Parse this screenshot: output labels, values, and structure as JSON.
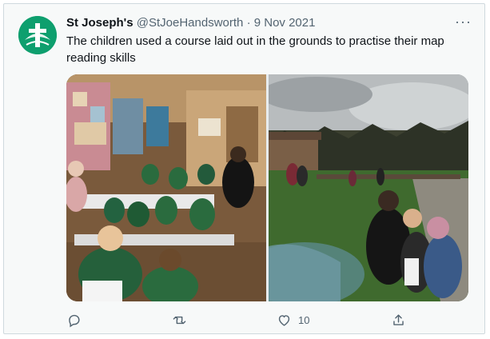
{
  "tweet": {
    "display_name": "St Joseph's",
    "handle": "@StJoeHandsworth",
    "separator": "·",
    "date": "9 Nov 2021",
    "more_label": "···",
    "text": "The children used a course laid out in the grounds to practise their map reading skills"
  },
  "media": {
    "images": [
      {
        "name": "classroom-photo"
      },
      {
        "name": "outdoor-photo"
      }
    ]
  },
  "actions": {
    "reply_count": "",
    "retweet_count": "",
    "like_count": "10",
    "share_count": ""
  },
  "colors": {
    "avatar_green": "#0e9f6e",
    "text": "#0f1419",
    "muted": "#536471",
    "border": "#cfd9de"
  }
}
